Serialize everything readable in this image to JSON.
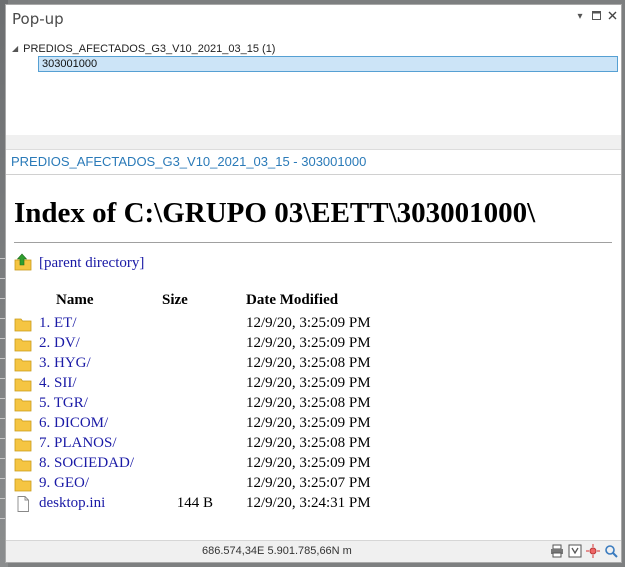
{
  "window": {
    "title": "Pop-up",
    "menu_icon": "chevron-down-icon",
    "restore_icon": "restore-icon",
    "close_icon": "close-icon"
  },
  "tree": {
    "layer_label": "PREDIOS_AFECTADOS_G3_V10_2021_03_15  (1)",
    "selected_feature": "303001000"
  },
  "feature": {
    "title": "PREDIOS_AFECTADOS_G3_V10_2021_03_15 - 303001000"
  },
  "directory": {
    "heading": "Index of C:\\GRUPO 03\\EETT\\303001000\\",
    "parent_link": "[parent directory]",
    "columns": {
      "name": "Name",
      "size": "Size",
      "modified": "Date Modified"
    },
    "entries": [
      {
        "name": "1. ET/",
        "size": "",
        "modified": "12/9/20, 3:25:09 PM",
        "icon": "folder-icon"
      },
      {
        "name": "2. DV/",
        "size": "",
        "modified": "12/9/20, 3:25:09 PM",
        "icon": "folder-icon"
      },
      {
        "name": "3. HYG/",
        "size": "",
        "modified": "12/9/20, 3:25:08 PM",
        "icon": "folder-icon"
      },
      {
        "name": "4. SII/",
        "size": "",
        "modified": "12/9/20, 3:25:09 PM",
        "icon": "folder-icon"
      },
      {
        "name": "5. TGR/",
        "size": "",
        "modified": "12/9/20, 3:25:08 PM",
        "icon": "folder-icon"
      },
      {
        "name": "6. DICOM/",
        "size": "",
        "modified": "12/9/20, 3:25:09 PM",
        "icon": "folder-icon"
      },
      {
        "name": "7. PLANOS/",
        "size": "",
        "modified": "12/9/20, 3:25:08 PM",
        "icon": "folder-icon"
      },
      {
        "name": "8. SOCIEDAD/",
        "size": "",
        "modified": "12/9/20, 3:25:09 PM",
        "icon": "folder-icon"
      },
      {
        "name": "9. GEO/",
        "size": "",
        "modified": "12/9/20, 3:25:07 PM",
        "icon": "folder-icon"
      },
      {
        "name": "desktop.ini",
        "size": "144 B",
        "modified": "12/9/20, 3:24:31 PM",
        "icon": "file-icon"
      }
    ]
  },
  "status": {
    "coordinates": "686.574,34E 5.901.785,66N m",
    "tools": [
      "print-icon",
      "export-icon",
      "flash-icon",
      "zoom-to-icon"
    ]
  },
  "colors": {
    "link": "#1a1aa6",
    "feature_title": "#2a7ab8",
    "selection_fill": "#cce4f7",
    "selection_border": "#56a0d3",
    "folder": "#f5c542"
  }
}
